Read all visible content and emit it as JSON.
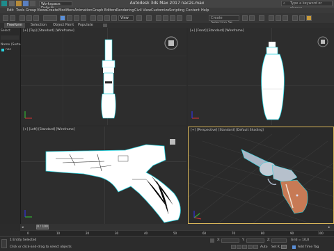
{
  "titlebar": {
    "workspace": "Workspace: Default",
    "title": "Autodesk 3ds Max 2017   nac2s.max",
    "search_placeholder": "Type a keyword or phrase"
  },
  "menus": [
    "Edit",
    "Tools",
    "Group",
    "Views",
    "Create",
    "Modifiers",
    "Animation",
    "Graph Editors",
    "Rendering",
    "Civil View",
    "Customize",
    "Scripting",
    "Content",
    "Help"
  ],
  "toolbar": {
    "view_dropdown": "View",
    "selection_set": "Create Selection Se"
  },
  "ribbon": {
    "tabs": [
      "Freeform",
      "Selection",
      "Object Paint",
      "Populate"
    ]
  },
  "left_panel": {
    "select_label": "Select",
    "name_sorted": "Name (Sorted As",
    "item": "nac"
  },
  "viewports": {
    "top": "[+] [Top] [Standard] [Wireframe]",
    "front": "[+] [Front] [Standard] [Wireframe]",
    "left": "[+] [Left] [Standard] [Wireframe]",
    "perspective": "[+] [Perspective] [Standard] [Default Shading]"
  },
  "timeline": {
    "frame": "0 / 100",
    "ticks": [
      "0",
      "10",
      "20",
      "30",
      "40",
      "50",
      "60",
      "70",
      "80",
      "90",
      "100"
    ]
  },
  "status": {
    "selected": "1 Entity Selected",
    "prompt": "Click or click-and-drag to select objects",
    "x_label": "X:",
    "y_label": "Y:",
    "z_label": "Z:",
    "grid": "Grid = 10,0",
    "add_time_tag": "Add Time Tag",
    "auto": "Auto",
    "set_key": "Set K."
  },
  "colors": {
    "accent": "#d9b65a",
    "wire": "#ffffff",
    "selection": "#29d4e0"
  }
}
